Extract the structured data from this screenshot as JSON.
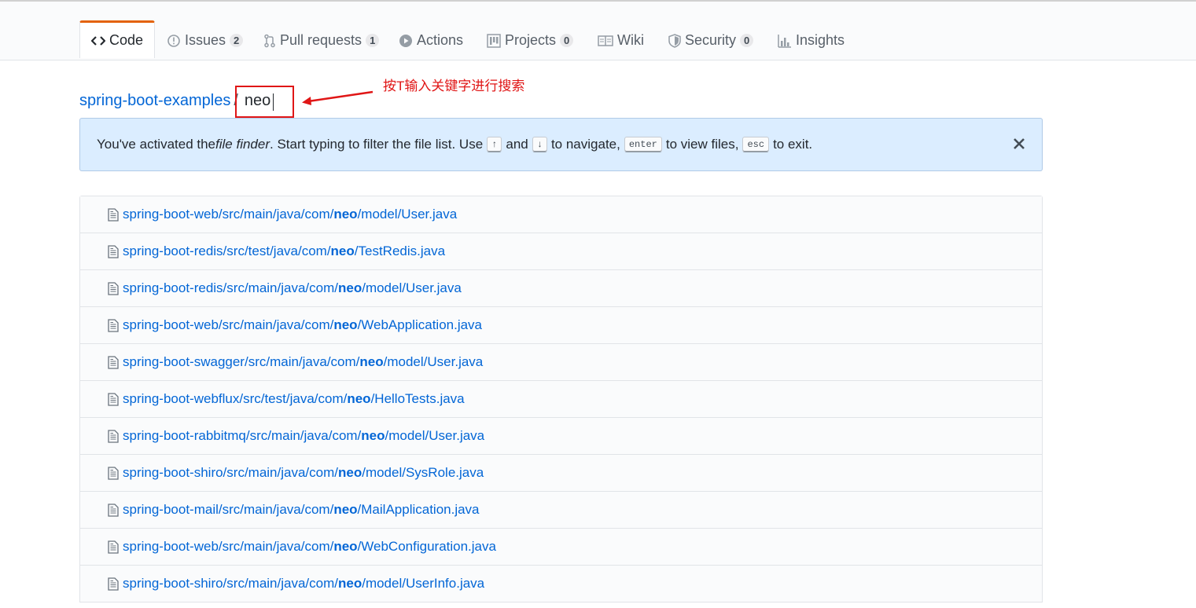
{
  "tabs": [
    {
      "label": "Code",
      "icon": "code-icon",
      "active": true
    },
    {
      "label": "Issues",
      "icon": "issue-icon",
      "count": "2"
    },
    {
      "label": "Pull requests",
      "icon": "pull-request-icon",
      "count": "1"
    },
    {
      "label": "Actions",
      "icon": "play-icon"
    },
    {
      "label": "Projects",
      "icon": "project-icon",
      "count": "0"
    },
    {
      "label": "Wiki",
      "icon": "book-icon"
    },
    {
      "label": "Security",
      "icon": "shield-icon",
      "count": "0"
    },
    {
      "label": "Insights",
      "icon": "graph-icon"
    }
  ],
  "breadcrumb": {
    "repo": "spring-boot-examples",
    "separator": "/",
    "query": "neo"
  },
  "annotation": {
    "text": "按T输入关键字进行搜索",
    "color": "#e01616"
  },
  "flash": {
    "text_1": "You've activated the ",
    "emphasis": "file finder",
    "text_2": ". Start typing to filter the file list. Use ",
    "key_up": "↑",
    "text_3": " and ",
    "key_down": "↓",
    "text_4": " to navigate, ",
    "key_enter": "enter",
    "text_5": " to view files, ",
    "key_esc": "esc",
    "text_6": " to exit.",
    "close_icon": "close-icon"
  },
  "files": [
    {
      "prefix": "spring-boot-web/src/main/java/com/",
      "match": "neo",
      "suffix": "/model/User.java"
    },
    {
      "prefix": "spring-boot-redis/src/test/java/com/",
      "match": "neo",
      "suffix": "/TestRedis.java"
    },
    {
      "prefix": "spring-boot-redis/src/main/java/com/",
      "match": "neo",
      "suffix": "/model/User.java"
    },
    {
      "prefix": "spring-boot-web/src/main/java/com/",
      "match": "neo",
      "suffix": "/WebApplication.java"
    },
    {
      "prefix": "spring-boot-swagger/src/main/java/com/",
      "match": "neo",
      "suffix": "/model/User.java"
    },
    {
      "prefix": "spring-boot-webflux/src/test/java/com/",
      "match": "neo",
      "suffix": "/HelloTests.java"
    },
    {
      "prefix": "spring-boot-rabbitmq/src/main/java/com/",
      "match": "neo",
      "suffix": "/model/User.java"
    },
    {
      "prefix": "spring-boot-shiro/src/main/java/com/",
      "match": "neo",
      "suffix": "/model/SysRole.java"
    },
    {
      "prefix": "spring-boot-mail/src/main/java/com/",
      "match": "neo",
      "suffix": "/MailApplication.java"
    },
    {
      "prefix": "spring-boot-web/src/main/java/com/",
      "match": "neo",
      "suffix": "/WebConfiguration.java"
    },
    {
      "prefix": "spring-boot-shiro/src/main/java/com/",
      "match": "neo",
      "suffix": "/model/UserInfo.java"
    }
  ],
  "colors": {
    "link": "#0366d6",
    "active_tab_accent": "#e36209",
    "flash_bg": "#dbedff"
  }
}
